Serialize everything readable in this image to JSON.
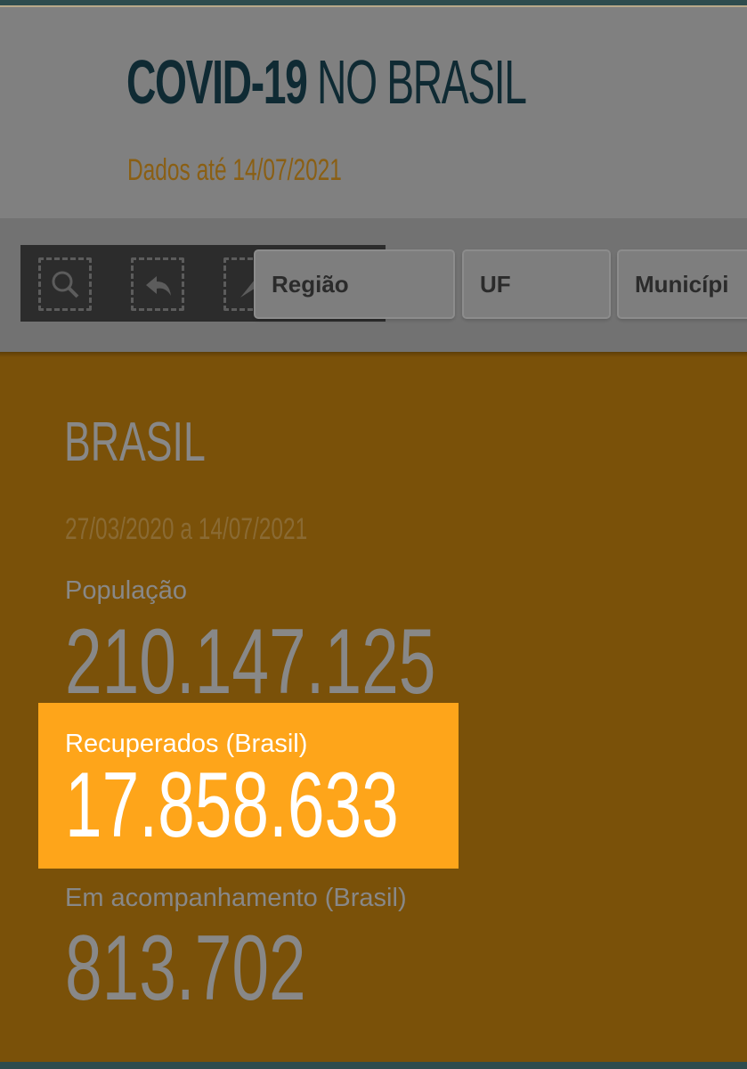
{
  "header": {
    "title_bold": "COVID-19",
    "title_light": "NO BRASIL",
    "updated": "Dados até 14/07/2021"
  },
  "toolbar": {
    "icons": [
      "zoom-selection-icon",
      "undo-selection-icon",
      "selection-icon"
    ]
  },
  "filters": {
    "regiao": "Região",
    "uf": "UF",
    "municipio": "Municípi"
  },
  "summary": {
    "region": "BRASIL",
    "period": "27/03/2020 a 14/07/2021",
    "population_label": "População",
    "population_value": "210.147.125",
    "recovered_label": "Recuperados (Brasil)",
    "recovered_value": "17.858.633",
    "monitoring_label": "Em acompanhamento (Brasil)",
    "monitoring_value": "813.702"
  },
  "colors": {
    "header_bg": "#808080",
    "title": "#0f2a33",
    "accent": "#fea51a",
    "panel_bg": "#7a5109",
    "stripe": "#2e4c4e"
  }
}
